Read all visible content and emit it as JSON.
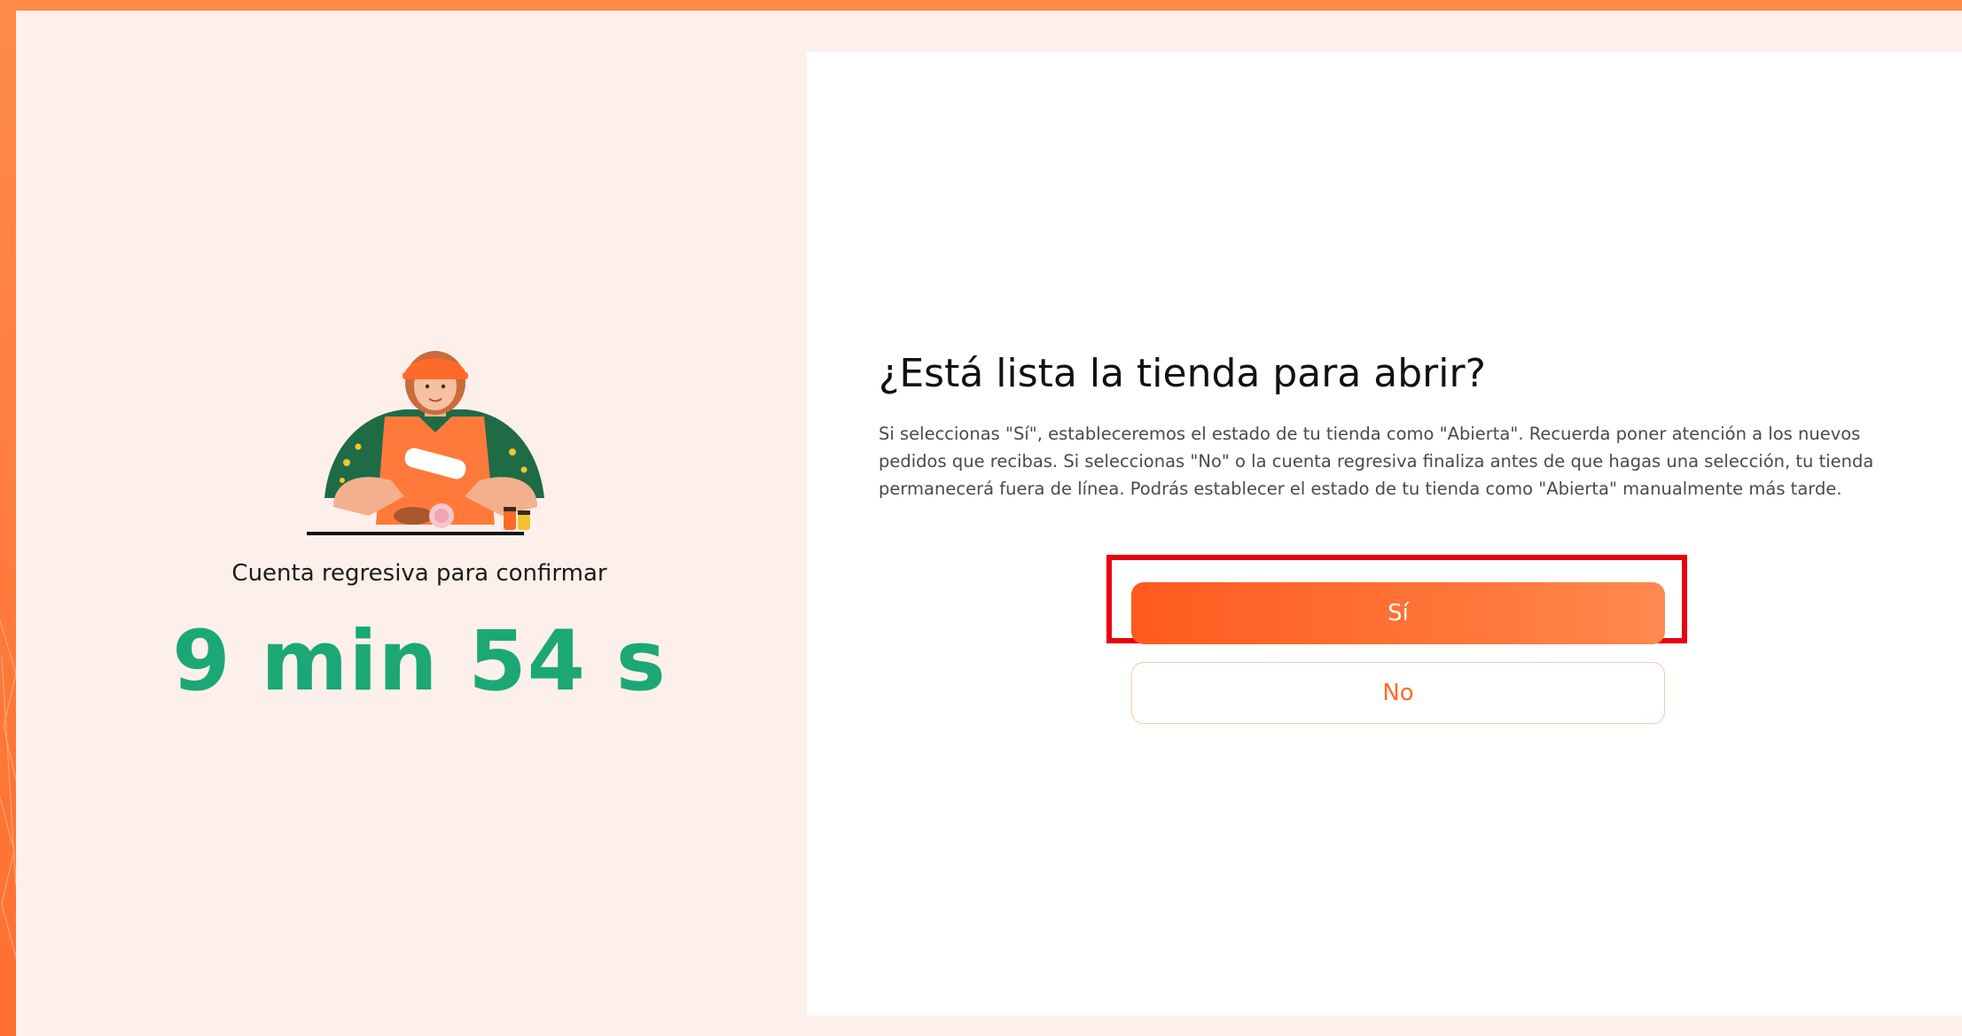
{
  "countdown": {
    "label": "Cuenta regresiva para confirmar",
    "value": "9 min 54 s"
  },
  "dialog": {
    "title": "¿Está lista la tienda para abrir?",
    "description": "Si seleccionas \"Sí\", estableceremos el estado de tu tienda como \"Abierta\". Recuerda poner atención a los nuevos pedidos que recibas. Si seleccionas \"No\" o la cuenta regresiva finaliza antes de que hagas una selección, tu tienda permanecerá fuera de línea. Podrás establecer el estado de tu tienda como \"Abierta\" manualmente más tarde.",
    "yes_label": "Sí",
    "no_label": "No"
  },
  "colors": {
    "accent": "#ff6a2a",
    "countdown": "#1ba876",
    "highlight": "#e8000e",
    "frame": "#ff7a3a",
    "background": "#fdf0eb"
  },
  "illustration": {
    "icon": "chef-cooking-illustration"
  }
}
